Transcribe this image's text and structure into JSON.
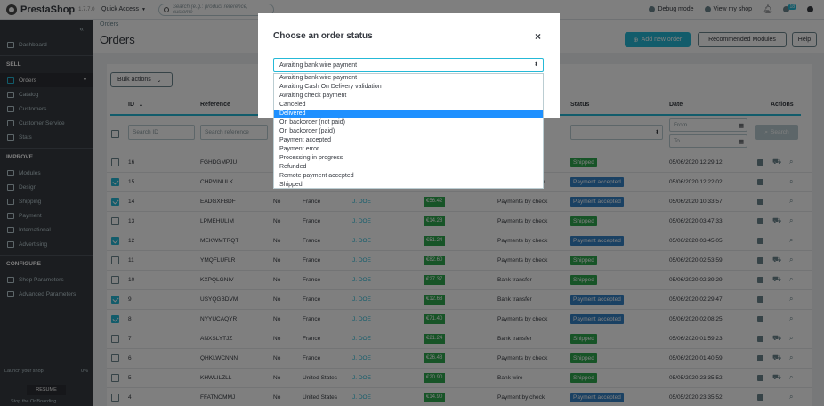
{
  "topbar": {
    "brand": "PrestaShop",
    "version": "1.7.7.0",
    "quick_access": "Quick Access",
    "search_placeholder": "Search (e.g.: product reference, custome",
    "debug_mode": "Debug mode",
    "view_shop": "View my shop",
    "notif_count": "18"
  },
  "sidebar": {
    "dashboard": "Dashboard",
    "sell": "SELL",
    "sell_items": [
      "Orders",
      "Catalog",
      "Customers",
      "Customer Service",
      "Stats"
    ],
    "improve": "IMPROVE",
    "improve_items": [
      "Modules",
      "Design",
      "Shipping",
      "Payment",
      "International",
      "Advertising"
    ],
    "configure": "CONFIGURE",
    "configure_items": [
      "Shop Parameters",
      "Advanced Parameters"
    ],
    "launch": "Launch your shop!",
    "launch_pct": "0%",
    "resume": "RESUME",
    "stop": "Stop the OnBoarding"
  },
  "header": {
    "breadcrumb": "Orders",
    "title": "Orders",
    "add_new": "Add new order",
    "recommended": "Recommended Modules",
    "help": "Help"
  },
  "table": {
    "bulk_actions": "Bulk actions",
    "col_id": "ID",
    "col_reference": "Reference",
    "col_status": "Status",
    "col_date": "Date",
    "col_actions": "Actions",
    "search_id": "Search ID",
    "search_reference": "Search reference",
    "from": "From",
    "to": "To",
    "search_btn": "Search",
    "rows": [
      {
        "id": "16",
        "ref": "FGHDGMPJU",
        "new": "",
        "country": "",
        "customer": "",
        "total": "",
        "payment": "",
        "status": "Shipped",
        "date": "05/06/2020 12:29:12",
        "checked": false
      },
      {
        "id": "15",
        "ref": "CHPVINULK",
        "new": "",
        "country": "",
        "customer": "",
        "total": "",
        "payment": "ck",
        "status": "Payment accepted",
        "date": "05/06/2020 12:22:02",
        "checked": true
      },
      {
        "id": "14",
        "ref": "EADGXFBDF",
        "new": "No",
        "country": "France",
        "customer": "J. DOE",
        "total": "€56.42",
        "payment": "Payments by check",
        "status": "Payment accepted",
        "date": "05/06/2020 10:33:57",
        "checked": true
      },
      {
        "id": "13",
        "ref": "LPMEHULIM",
        "new": "No",
        "country": "France",
        "customer": "J. DOE",
        "total": "€14.28",
        "payment": "Payments by check",
        "status": "Shipped",
        "date": "05/06/2020 03:47:33",
        "checked": false
      },
      {
        "id": "12",
        "ref": "MEKWMTRQT",
        "new": "No",
        "country": "France",
        "customer": "J. DOE",
        "total": "€51.24",
        "payment": "Payments by check",
        "status": "Payment accepted",
        "date": "05/06/2020 03:45:05",
        "checked": true
      },
      {
        "id": "11",
        "ref": "YMQFLUFLR",
        "new": "No",
        "country": "France",
        "customer": "J. DOE",
        "total": "€82.60",
        "payment": "Payments by check",
        "status": "Shipped",
        "date": "05/06/2020 02:53:59",
        "checked": false
      },
      {
        "id": "10",
        "ref": "KXPQLGNIV",
        "new": "No",
        "country": "France",
        "customer": "J. DOE",
        "total": "€27.37",
        "payment": "Bank transfer",
        "status": "Shipped",
        "date": "05/06/2020 02:39:29",
        "checked": false
      },
      {
        "id": "9",
        "ref": "USYQGBDVM",
        "new": "No",
        "country": "France",
        "customer": "J. DOE",
        "total": "€12.68",
        "payment": "Bank transfer",
        "status": "Payment accepted",
        "date": "05/06/2020 02:29:47",
        "checked": true
      },
      {
        "id": "8",
        "ref": "NYYUCAQYR",
        "new": "No",
        "country": "France",
        "customer": "J. DOE",
        "total": "€71.40",
        "payment": "Payments by check",
        "status": "Payment accepted",
        "date": "05/06/2020 02:08:25",
        "checked": true
      },
      {
        "id": "7",
        "ref": "ANXSLYTJZ",
        "new": "No",
        "country": "France",
        "customer": "J. DOE",
        "total": "€21.24",
        "payment": "Bank transfer",
        "status": "Shipped",
        "date": "05/06/2020 01:59:23",
        "checked": false
      },
      {
        "id": "6",
        "ref": "QHKLWCNNN",
        "new": "No",
        "country": "France",
        "customer": "J. DOE",
        "total": "€26.48",
        "payment": "Payments by check",
        "status": "Shipped",
        "date": "05/06/2020 01:40:59",
        "checked": false
      },
      {
        "id": "5",
        "ref": "KHWLILZLL",
        "new": "No",
        "country": "United States",
        "customer": "J. DOE",
        "total": "€20.90",
        "payment": "Bank wire",
        "status": "Shipped",
        "date": "05/05/2020 23:35:52",
        "checked": false
      },
      {
        "id": "4",
        "ref": "FFATNOMMJ",
        "new": "No",
        "country": "United States",
        "customer": "J. DOE",
        "total": "€14.90",
        "payment": "Payment by check",
        "status": "Payment accepted",
        "date": "05/05/2020 23:35:52",
        "checked": false
      }
    ]
  },
  "colors": {
    "shipped": "#2ea84e",
    "payment_accepted": "#3583c7",
    "accent": "#25b9d7",
    "amount": "#2ea84e"
  },
  "modal": {
    "title": "Choose an order status",
    "close": "×",
    "selected": "Awaiting bank wire payment",
    "options": [
      "Awaiting bank wire payment",
      "Awaiting Cash On Delivery validation",
      "Awaiting check payment",
      "Canceled",
      "Delivered",
      "On backorder (not paid)",
      "On backorder (paid)",
      "Payment accepted",
      "Payment error",
      "Processing in progress",
      "Refunded",
      "Remote payment accepted",
      "Shipped"
    ],
    "highlighted_index": 4
  }
}
